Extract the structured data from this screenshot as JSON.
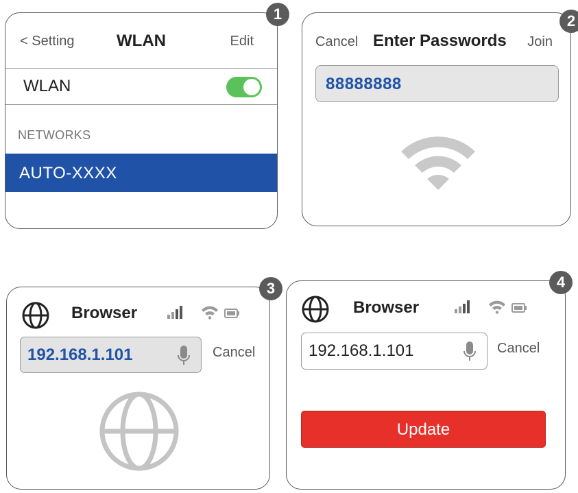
{
  "steps": [
    "1",
    "2",
    "3",
    "4"
  ],
  "wlan_screen": {
    "back_label": "< Setting",
    "title": "WLAN",
    "edit_label": "Edit",
    "wlan_row_label": "WLAN",
    "wlan_toggle_on": true,
    "section_label": "NETWORKS",
    "network_name": "AUTO-XXXX",
    "selected_color": "#2053a8",
    "toggle_color": "#5bc15b"
  },
  "password_screen": {
    "cancel_label": "Cancel",
    "title": "Enter Passwords",
    "join_label": "Join",
    "password_value": "88888888",
    "icon": "wifi-icon"
  },
  "browser_screen_1": {
    "title": "Browser",
    "url_value": "192.168.1.101",
    "cancel_label": "Cancel",
    "icons": [
      "globe-icon",
      "signal-icon",
      "wifi-icon",
      "battery-icon",
      "microphone-icon"
    ]
  },
  "browser_screen_2": {
    "title": "Browser",
    "url_value": "192.168.1.101",
    "cancel_label": "Cancel",
    "update_label": "Update",
    "update_color": "#e8302a"
  }
}
